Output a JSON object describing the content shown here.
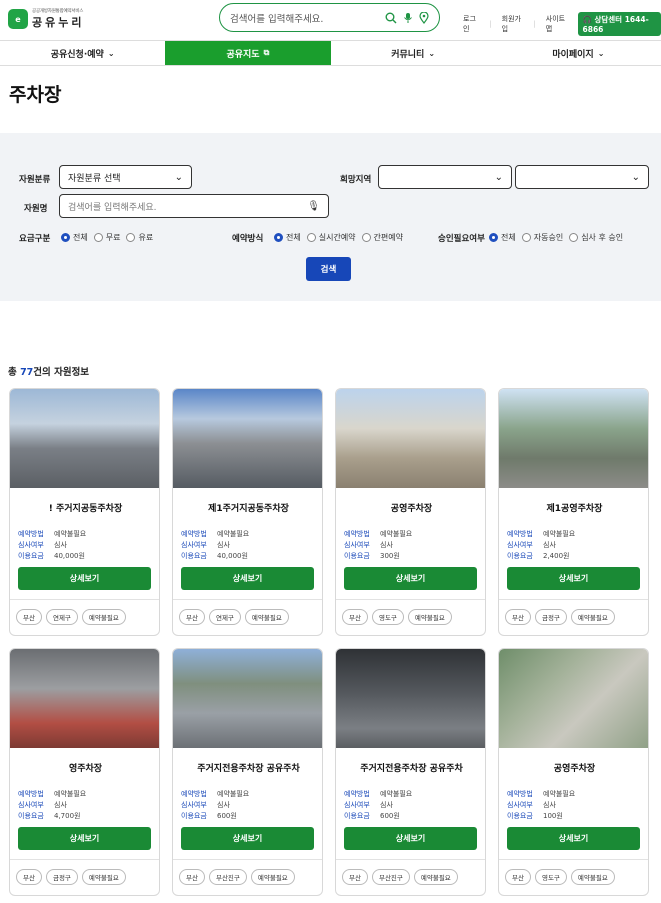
{
  "header": {
    "logo_mark": "e",
    "logo_sub": "공공개방자원통합예약서비스",
    "logo_name": "공유누리",
    "search_placeholder": "검색어를 입력해주세요.",
    "links": [
      "로그인",
      "회원가입",
      "사이트맵"
    ],
    "call_center": "상담센터 1644-6866"
  },
  "nav": [
    {
      "label": "공유신청·예약",
      "icon": "chevron-down"
    },
    {
      "label": "공유지도",
      "icon": "external-link"
    },
    {
      "label": "커뮤니티",
      "icon": "chevron-down"
    },
    {
      "label": "마이페이지",
      "icon": "chevron-down"
    }
  ],
  "page_title": "주차장",
  "filter": {
    "resource_type_label": "자원분류",
    "resource_type_value": "자원분류 선택",
    "region_label": "희망지역",
    "region_value_1": "",
    "region_value_2": "",
    "resource_name_label": "자원명",
    "resource_name_placeholder": "검색어를 입력해주세요.",
    "fee_label": "요금구분",
    "fee_options": [
      "전체",
      "무료",
      "유료"
    ],
    "reserve_label": "예약방식",
    "reserve_options": [
      "전체",
      "실시간예약",
      "간편예약"
    ],
    "approval_label": "승인필요여부",
    "approval_options": [
      "전체",
      "자동승인",
      "심사 후 승인"
    ],
    "search_button": "검색"
  },
  "total": {
    "prefix": "총 ",
    "count": "77",
    "suffix": "건의 자원정보"
  },
  "card_labels": {
    "method": "예약방법",
    "review": "심사여부",
    "fee": "이용요금",
    "detail": "상세보기"
  },
  "cards": [
    {
      "title": "! 주거지공동주차장",
      "method": "예약불필요",
      "review": "심사",
      "fee": "40,000원",
      "tags": [
        "부산",
        "연제구",
        "예약불필요"
      ]
    },
    {
      "title": "제1주거지공동주차장",
      "method": "예약불필요",
      "review": "심사",
      "fee": "40,000원",
      "tags": [
        "부산",
        "연제구",
        "예약불필요"
      ]
    },
    {
      "title": "공영주차장",
      "method": "예약불필요",
      "review": "심사",
      "fee": "300원",
      "tags": [
        "부산",
        "영도구",
        "예약불필요"
      ]
    },
    {
      "title": "제1공영주차장",
      "method": "예약불필요",
      "review": "심사",
      "fee": "2,400원",
      "tags": [
        "부산",
        "금정구",
        "예약불필요"
      ]
    },
    {
      "title": "영주차장",
      "method": "예약불필요",
      "review": "심사",
      "fee": "4,700원",
      "tags": [
        "부산",
        "금정구",
        "예약불필요"
      ]
    },
    {
      "title": "주거지전용주차장 공유주차",
      "method": "예약불필요",
      "review": "심사",
      "fee": "600원",
      "tags": [
        "부산",
        "부산진구",
        "예약불필요"
      ]
    },
    {
      "title": "주거지전용주차장 공유주차",
      "method": "예약불필요",
      "review": "심사",
      "fee": "600원",
      "tags": [
        "부산",
        "부산진구",
        "예약불필요"
      ]
    },
    {
      "title": "공영주차장",
      "method": "예약불필요",
      "review": "심사",
      "fee": "100원",
      "tags": [
        "부산",
        "영도구",
        "예약불필요"
      ]
    }
  ]
}
